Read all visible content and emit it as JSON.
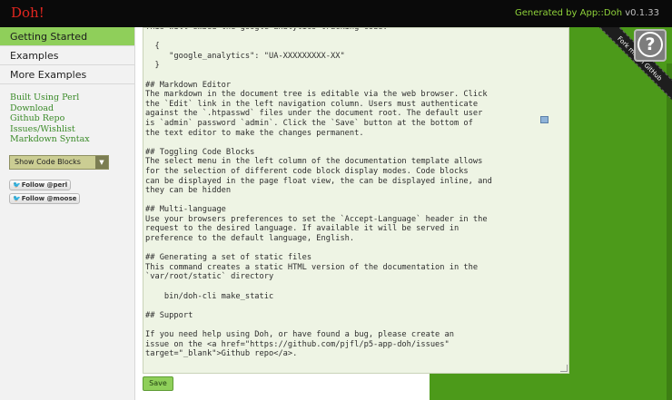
{
  "header": {
    "brand": "Doh!",
    "generated_label": "Generated by",
    "generated_link": "App::Doh",
    "version": "v0.1.33"
  },
  "sidebar": {
    "nav": [
      {
        "label": "Getting Started"
      },
      {
        "label": "Examples"
      },
      {
        "label": "More Examples"
      }
    ],
    "links": [
      {
        "label": "Built Using Perl"
      },
      {
        "label": "Download"
      },
      {
        "label": "Github Repo"
      },
      {
        "label": "Issues/Wishlist"
      },
      {
        "label": "Markdown Syntax"
      }
    ],
    "code_block_select": {
      "selected": "Show Code Blocks"
    },
    "follow_buttons": [
      {
        "label": "Follow @perl"
      },
      {
        "label": "Follow @moose"
      }
    ]
  },
  "editor": {
    "content": "This will embed the google analytics tracking code:\n\n  {\n     \"google_analytics\": \"UA-XXXXXXXXX-XX\"\n  }\n\n## Markdown Editor\nThe markdown in the document tree is editable via the web browser. Click\nthe `Edit` link in the left navigation column. Users must authenticate\nagainst the `.htpasswd` files under the document root. The default user\nis `admin` password `admin`. Click the `Save` button at the bottom of\nthe text editor to make the changes permanent.\n\n## Toggling Code Blocks\nThe select menu in the left column of the documentation template allows\nfor the selection of different code block display modes. Code blocks\ncan be displayed in the page float view, the can be displayed inline, and\nthey can be hidden\n\n## Multi-language\nUse your browsers preferences to set the `Accept-Language` header in the\nrequest to the desired language. If available it will be served in\npreference to the default language, English.\n\n## Generating a set of static files\nThis command creates a static HTML version of the documentation in the\n`var/root/static` directory\n\n    bin/doh-cli make_static\n\n## Support\n\nIf you need help using Doh, or have found a bug, please create an\nissue on the <a href=\"https://github.com/pjfl/p5-app-doh/issues\"\ntarget=\"_blank\">Github repo</a>.",
    "save_label": "Save"
  },
  "ribbon": {
    "label": "Fork me on GitHub"
  },
  "help": {
    "label": "?"
  }
}
